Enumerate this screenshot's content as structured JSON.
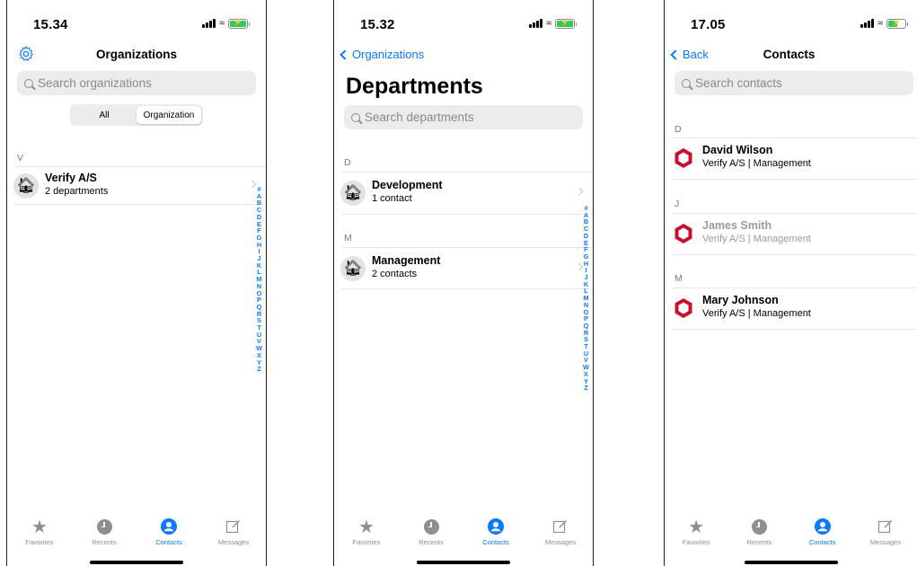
{
  "colors": {
    "accent": "#0a7aff",
    "battery": "#34c759",
    "logo": "#c8102e"
  },
  "tabs": [
    "Favorites",
    "Recents",
    "Contacts",
    "Messages"
  ],
  "index_letters": [
    "#",
    "A",
    "B",
    "C",
    "D",
    "E",
    "F",
    "G",
    "H",
    "I",
    "J",
    "K",
    "L",
    "M",
    "N",
    "O",
    "P",
    "Q",
    "R",
    "S",
    "T",
    "U",
    "V",
    "W",
    "X",
    "Y",
    "Z"
  ],
  "screen1": {
    "time": "15.34",
    "title": "Organizations",
    "search_placeholder": "Search organizations",
    "segments": [
      "All",
      "Organization"
    ],
    "section": "V",
    "row": {
      "name": "Verify A/S",
      "sub": "2 departments"
    }
  },
  "screen2": {
    "time": "15.32",
    "back": "Organizations",
    "title": "Departments",
    "search_placeholder": "Search departments",
    "sections": [
      {
        "letter": "D",
        "name": "Development",
        "sub": "1 contact"
      },
      {
        "letter": "M",
        "name": "Management",
        "sub": "2 contacts"
      }
    ]
  },
  "screen3": {
    "time": "17.05",
    "back": "Back",
    "title": "Contacts",
    "search_placeholder": "Search contacts",
    "sections": [
      {
        "letter": "D",
        "name": "David Wilson",
        "sub": "Verify A/S | Management"
      },
      {
        "letter": "J",
        "name": "James Smith",
        "sub": "Verify A/S | Management"
      },
      {
        "letter": "M",
        "name": "Mary Johnson",
        "sub": "Verify A/S | Management"
      }
    ]
  }
}
